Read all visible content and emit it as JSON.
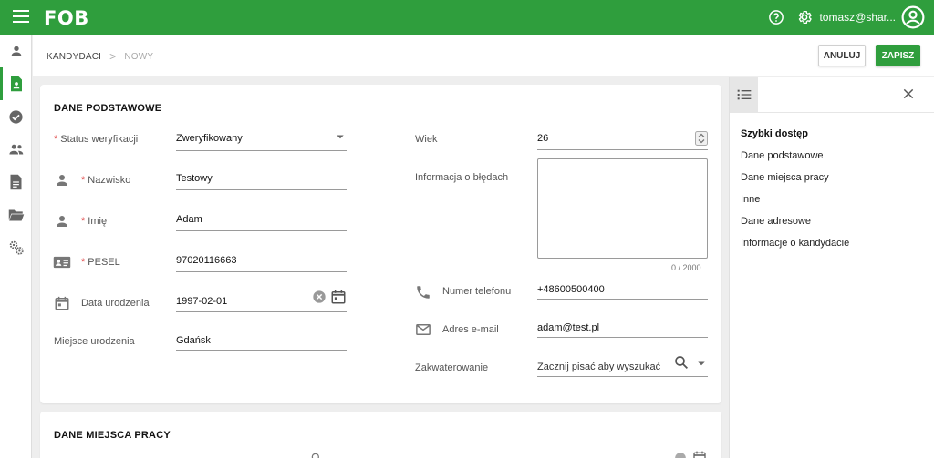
{
  "app": {
    "logo": "FOB",
    "user_name": "tomasz@shar..."
  },
  "breadcrumb": {
    "first": "KANDYDACI",
    "separator": ">",
    "current": "NOWY"
  },
  "actions": {
    "cancel_label": "ANULUJ",
    "save_label": "ZAPISZ"
  },
  "section1": {
    "title": "DANE PODSTAWOWE",
    "status_label": "Status weryfikacji",
    "status_value": "Zweryfikowany",
    "surname_label": "Nazwisko",
    "surname_value": "Testowy",
    "name_label": "Imię",
    "name_value": "Adam",
    "pesel_label": "PESEL",
    "pesel_value": "97020116663",
    "birthdate_label": "Data urodzenia",
    "birthdate_value": "1997-02-01",
    "birthplace_label": "Miejsce urodzenia",
    "birthplace_value": "Gdańsk",
    "age_label": "Wiek",
    "age_value": "26",
    "errors_label": "Informacja o błędach",
    "errors_counter": "0 / 2000",
    "phone_label": "Numer telefonu",
    "phone_value": "+48600500400",
    "email_label": "Adres e-mail",
    "email_value": "adam@test.pl",
    "accommodation_label": "Zakwaterowanie",
    "accommodation_placeholder": "Zacznij pisać aby wyszukać"
  },
  "section2": {
    "title": "DANE MIEJSCA PRACY"
  },
  "quick_access": {
    "title": "Szybki dostęp",
    "links": [
      "Dane podstawowe",
      "Dane miejsca pracy",
      "Inne",
      "Dane adresowe",
      "Informacje o kandydacie"
    ]
  },
  "colors": {
    "primary": "#2f9e3d",
    "required": "#d33333"
  }
}
